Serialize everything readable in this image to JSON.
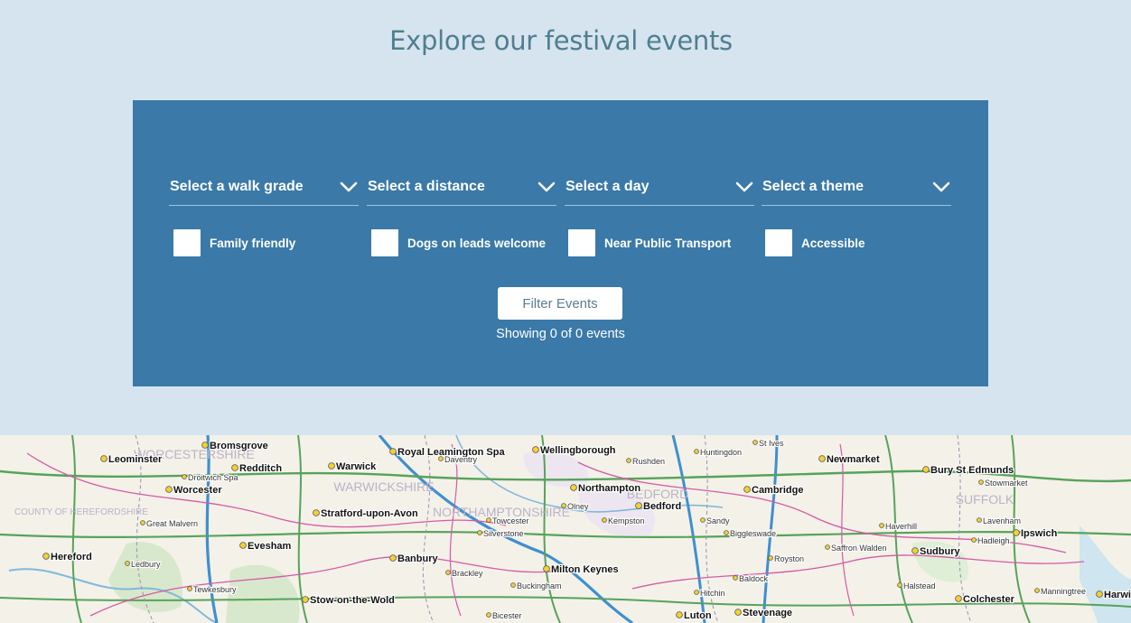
{
  "page": {
    "title": "Explore our festival events"
  },
  "filters": {
    "selects": [
      {
        "label": "Select a walk grade",
        "icon": "chevron-down-icon"
      },
      {
        "label": "Select a distance",
        "icon": "chevron-down-icon"
      },
      {
        "label": "Select a day",
        "icon": "chevron-down-icon"
      },
      {
        "label": "Select a theme",
        "icon": "chevron-down-icon"
      }
    ],
    "checkboxes": [
      {
        "label": "Family friendly",
        "checked": false
      },
      {
        "label": "Dogs on leads welcome",
        "checked": false
      },
      {
        "label": "Near Public Transport",
        "checked": false
      },
      {
        "label": "Accessible",
        "checked": false
      }
    ],
    "button_label": "Filter Events",
    "results_text": "Showing 0 of 0 events"
  },
  "map": {
    "places": [
      {
        "name": "Bromsgrove",
        "major": true
      },
      {
        "name": "Redditch",
        "major": true
      },
      {
        "name": "Warwick",
        "major": true
      },
      {
        "name": "Royal Leamington Spa",
        "major": true
      },
      {
        "name": "Wellingborough",
        "major": true
      },
      {
        "name": "Rushden",
        "major": false
      },
      {
        "name": "St Ives",
        "major": false
      },
      {
        "name": "Newmarket",
        "major": true
      },
      {
        "name": "Bury St Edmunds",
        "major": true
      },
      {
        "name": "Leominster",
        "major": true
      },
      {
        "name": "Worcester",
        "major": true
      },
      {
        "name": "Northampton",
        "major": true
      },
      {
        "name": "Bedford",
        "major": true
      },
      {
        "name": "Cambridge",
        "major": true
      },
      {
        "name": "Stratford-upon-Avon",
        "major": true
      },
      {
        "name": "Evesham",
        "major": true
      },
      {
        "name": "Banbury",
        "major": true
      },
      {
        "name": "Milton Keynes",
        "major": true
      },
      {
        "name": "Hereford",
        "major": true
      },
      {
        "name": "Sudbury",
        "major": true
      },
      {
        "name": "Ipswich",
        "major": true
      },
      {
        "name": "Colchester",
        "major": true
      },
      {
        "name": "Harwich",
        "major": true
      },
      {
        "name": "Luton",
        "major": true
      },
      {
        "name": "Stevenage",
        "major": true
      },
      {
        "name": "Stow-on-the-Wold",
        "major": true
      },
      {
        "name": "Royston",
        "major": false
      },
      {
        "name": "Haverhill",
        "major": false
      },
      {
        "name": "Saffron Walden",
        "major": false
      },
      {
        "name": "Hitchin",
        "major": false
      },
      {
        "name": "Baldock",
        "major": false
      },
      {
        "name": "Olney",
        "major": false
      },
      {
        "name": "Sandy",
        "major": false
      },
      {
        "name": "Biggleswade",
        "major": false
      },
      {
        "name": "Kempston",
        "major": false
      },
      {
        "name": "Towcester",
        "major": false
      },
      {
        "name": "Silverstone",
        "major": false
      },
      {
        "name": "Tewkesbury",
        "major": false
      },
      {
        "name": "Ledbury",
        "major": false
      },
      {
        "name": "Great Malvern",
        "major": false
      },
      {
        "name": "Droitwich Spa",
        "major": false
      },
      {
        "name": "Stowmarket",
        "major": false
      },
      {
        "name": "Hadleigh",
        "major": false
      },
      {
        "name": "Lavenham",
        "major": false
      },
      {
        "name": "Halstead",
        "major": false
      },
      {
        "name": "Manningtree",
        "major": false
      },
      {
        "name": "Bicester",
        "major": false
      },
      {
        "name": "Buckingham",
        "major": false
      },
      {
        "name": "Brackley",
        "major": false
      },
      {
        "name": "Daventry",
        "major": false
      },
      {
        "name": "Huntingdon",
        "major": false
      }
    ],
    "regions": [
      "WORCESTERSHIRE",
      "WARWICKSHIRE",
      "NORTHAMPTONSHIRE",
      "BEDFORD",
      "SUFFOLK",
      "COUNTY OF HEREFORDSHIRE"
    ]
  },
  "colors": {
    "page_bg": "#d6e4f0",
    "panel_bg": "#3a79a8",
    "title": "#4f7f8f",
    "button_text": "#5b7d92"
  }
}
